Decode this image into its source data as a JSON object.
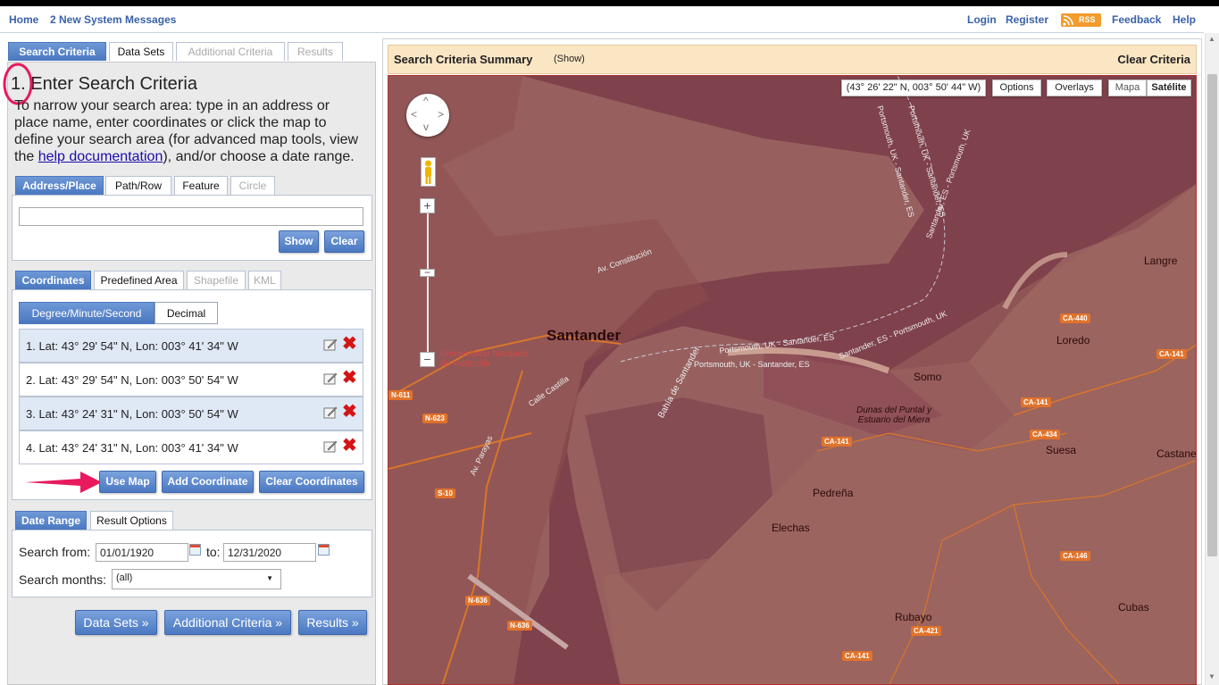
{
  "nav": {
    "home": "Home",
    "messages": "2 New System Messages",
    "login": "Login",
    "register": "Register",
    "rss": "RSS",
    "feedback": "Feedback",
    "help": "Help"
  },
  "main_tabs": [
    "Search Criteria",
    "Data Sets",
    "Additional Criteria",
    "Results"
  ],
  "step": {
    "number": "1.",
    "title": "Enter Search Criteria",
    "instructions_pre": "To narrow your search area: type in an address or place name, enter coordinates or click the map to define your search area (for advanced map tools, view the ",
    "link": "help documentation",
    "instructions_post": "), and/or choose a date range."
  },
  "area_tabs": [
    "Address/Place",
    "Path/Row",
    "Feature",
    "Circle"
  ],
  "address": {
    "value": "",
    "show": "Show",
    "clear": "Clear"
  },
  "coord_tabs": [
    "Coordinates",
    "Predefined Area",
    "Shapefile",
    "KML"
  ],
  "format_tabs": [
    "Degree/Minute/Second",
    "Decimal"
  ],
  "coordinates": [
    "1.  Lat: 43° 29' 54\" N, Lon: 003° 41' 34\" W",
    "2.  Lat: 43° 29' 54\" N, Lon: 003° 50' 54\" W",
    "3.  Lat: 43° 24' 31\" N, Lon: 003° 50' 54\" W",
    "4.  Lat: 43° 24' 31\" N, Lon: 003° 41' 34\" W"
  ],
  "coord_buttons": {
    "use_map": "Use Map",
    "add": "Add Coordinate",
    "clear": "Clear Coordinates"
  },
  "date_tabs": [
    "Date Range",
    "Result Options"
  ],
  "date": {
    "from_label": "Search from:",
    "from": "01/01/1920",
    "to_label": "to:",
    "to": "12/31/2020",
    "months_label": "Search months:",
    "months": "(all)"
  },
  "bottom_buttons": [
    "Data Sets »",
    "Additional Criteria »",
    "Results »"
  ],
  "map": {
    "summary_title": "Search Criteria Summary",
    "summary_show": "(Show)",
    "clear_criteria": "Clear Criteria",
    "coord_readout": "(43° 26' 22\" N, 003° 50' 44\" W)",
    "options": "Options",
    "overlays": "Overlays",
    "mapa": "Mapa",
    "satelite": "Satélite",
    "places": {
      "santander": "Santander",
      "university": "Universitario Marqués\nde Valdecilla",
      "somo": "Somo",
      "loredo": "Loredo",
      "langre": "Langre",
      "suesa": "Suesa",
      "castanedo": "Castaneo",
      "pedrena": "Pedreña",
      "elechas": "Elechas",
      "rubayo": "Rubayo",
      "cubas": "Cubas",
      "dunas": "Dunas del Puntal y\nEstuario del Miera",
      "bahia": "Bahía de Santander",
      "av_const": "Av. Constitución",
      "calle_castilla": "Calle Castilla",
      "av_parayas": "Av. Parayas",
      "ferry1": "Portsmouth, UK - Santander, ES",
      "ferry2": "Portsmouth, UK - Santander, ES",
      "ferry3": "Santander, ES - Portsmouth, UK",
      "ferry4": "Portsmouth, UK - Santander, ES",
      "ferry5": "Portsmouth, UK - Santander, ES",
      "ferry6": "Santander, ES - Portsmouth, UK"
    },
    "roads": [
      "CA-440",
      "CA-141",
      "CA-141",
      "CA-141",
      "CA-434",
      "CA-146",
      "CA-421",
      "CA-141",
      "N-611",
      "N-623",
      "S-10",
      "N-636",
      "N-636"
    ]
  },
  "colors": {
    "accent": "#4a77c0",
    "link": "#3a62a8",
    "map_tint": "#97605f",
    "annotation": "#e8195d"
  }
}
